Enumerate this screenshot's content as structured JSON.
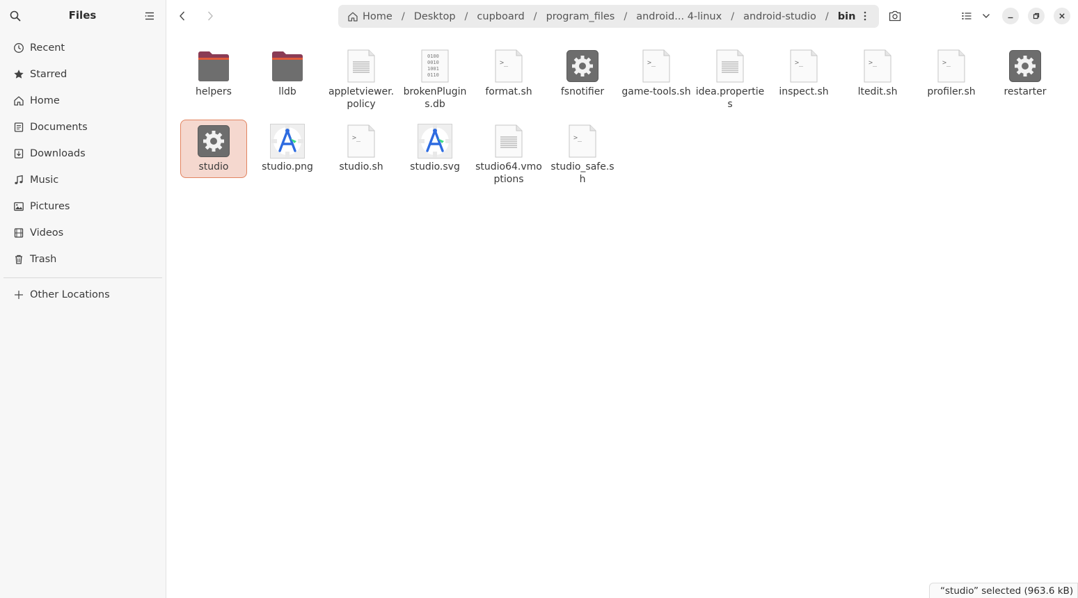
{
  "sidebar": {
    "title": "Files",
    "items": [
      {
        "label": "Recent",
        "icon": "clock-icon"
      },
      {
        "label": "Starred",
        "icon": "star-icon"
      },
      {
        "label": "Home",
        "icon": "home-icon"
      },
      {
        "label": "Documents",
        "icon": "document-icon"
      },
      {
        "label": "Downloads",
        "icon": "download-icon"
      },
      {
        "label": "Music",
        "icon": "music-icon"
      },
      {
        "label": "Pictures",
        "icon": "picture-icon"
      },
      {
        "label": "Videos",
        "icon": "video-icon"
      },
      {
        "label": "Trash",
        "icon": "trash-icon"
      }
    ],
    "other_locations": "Other Locations"
  },
  "pathbar": {
    "crumbs": [
      "Home",
      "Desktop",
      "cupboard",
      "program_files",
      "android... 4-linux",
      "android-studio",
      "bin"
    ]
  },
  "files": [
    {
      "name": "helpers",
      "type": "folder"
    },
    {
      "name": "lldb",
      "type": "folder"
    },
    {
      "name": "appletviewer.policy",
      "type": "text"
    },
    {
      "name": "brokenPlugins.db",
      "type": "binary"
    },
    {
      "name": "format.sh",
      "type": "script"
    },
    {
      "name": "fsnotifier",
      "type": "executable"
    },
    {
      "name": "game-tools.sh",
      "type": "script"
    },
    {
      "name": "idea.properties",
      "type": "text"
    },
    {
      "name": "inspect.sh",
      "type": "script"
    },
    {
      "name": "ltedit.sh",
      "type": "script"
    },
    {
      "name": "profiler.sh",
      "type": "script"
    },
    {
      "name": "restarter",
      "type": "executable"
    },
    {
      "name": "studio",
      "type": "executable",
      "selected": true
    },
    {
      "name": "studio.png",
      "type": "image"
    },
    {
      "name": "studio.sh",
      "type": "script"
    },
    {
      "name": "studio.svg",
      "type": "image"
    },
    {
      "name": "studio64.vmoptions",
      "type": "text"
    },
    {
      "name": "studio_safe.sh",
      "type": "script"
    }
  ],
  "status": "“studio” selected  (963.6 kB)",
  "colors": {
    "accent": "#e2835f",
    "selection_bg": "#f5d8cf",
    "folder": "#7a5560"
  }
}
